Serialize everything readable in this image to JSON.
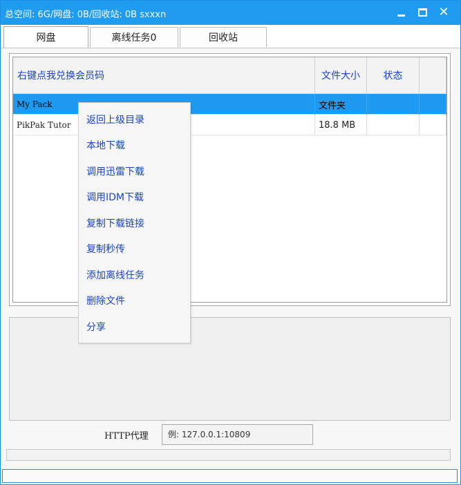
{
  "window": {
    "title": "总空间: 6G/网盘: 0B/回收站: 0B  sxxxn",
    "controls": {
      "minimize": "minimize",
      "maximize": "maximize",
      "close": "✕"
    }
  },
  "tabs": [
    {
      "label": "网盘",
      "active": true
    },
    {
      "label": "离线任务0",
      "active": false
    },
    {
      "label": "回收站",
      "active": false
    }
  ],
  "file_list": {
    "columns": [
      "右键点我兑换会员码",
      "文件大小",
      "状态",
      ""
    ],
    "rows": [
      {
        "name": "My Pack",
        "size": "文件夹",
        "status": "",
        "selected": true
      },
      {
        "name": "PikPak Tutor",
        "size": "18.8 MB",
        "status": "",
        "selected": false
      }
    ]
  },
  "context_menu": {
    "items": [
      "返回上级目录",
      "本地下载",
      "调用迅雷下载",
      "调用IDM下载",
      "复制下载链接",
      "复制秒传",
      "添加离线任务",
      "删除文件",
      "分享"
    ]
  },
  "proxy": {
    "label": "HTTP代理",
    "value": "",
    "placeholder": "例: 127.0.0.1:10809"
  },
  "colors": {
    "accent": "#1f9bf0",
    "selection": "#1e9af0",
    "link_text": "#1a44c6"
  }
}
